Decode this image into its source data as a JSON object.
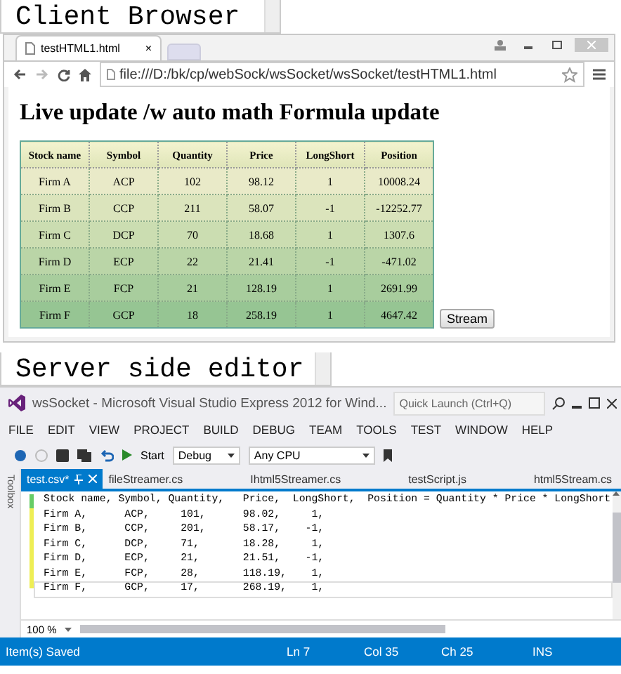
{
  "client_label": "Client Browser",
  "browser": {
    "tab": {
      "title": "testHTML1.html",
      "close": "×"
    },
    "url": "file:///D:/bk/cp/webSock/wsSocket/wsSocket/testHTML1.html",
    "heading": "Live update /w auto math Formula update",
    "table": {
      "columns": [
        "Stock name",
        "Symbol",
        "Quantity",
        "Price",
        "LongShort",
        "Position"
      ],
      "rows": [
        [
          "Firm A",
          "ACP",
          "102",
          "98.12",
          "1",
          "10008.24"
        ],
        [
          "Firm B",
          "CCP",
          "211",
          "58.07",
          "-1",
          "-12252.77"
        ],
        [
          "Firm C",
          "DCP",
          "70",
          "18.68",
          "1",
          "1307.6"
        ],
        [
          "Firm D",
          "ECP",
          "22",
          "21.41",
          "-1",
          "-471.02"
        ],
        [
          "Firm E",
          "FCP",
          "21",
          "128.19",
          "1",
          "2691.99"
        ],
        [
          "Firm F",
          "GCP",
          "18",
          "258.19",
          "1",
          "4647.42"
        ]
      ]
    },
    "button": "Stream"
  },
  "server_label": "Server side editor",
  "ide": {
    "title": "wsSocket - Microsoft Visual Studio Express 2012 for Wind...",
    "quick_launch": {
      "placeholder": "Quick Launch (Ctrl+Q)"
    },
    "menu": [
      "FILE",
      "EDIT",
      "VIEW",
      "PROJECT",
      "BUILD",
      "DEBUG",
      "TEAM",
      "TOOLS",
      "TEST",
      "WINDOW",
      "HELP"
    ],
    "toolbar": {
      "start": "Start",
      "config": "Debug",
      "platform": "Any CPU"
    },
    "toolbox": "Toolbox",
    "tabs": [
      {
        "label": "test.csv*",
        "selected": true
      },
      {
        "label": "fileStreamer.cs",
        "selected": false
      },
      {
        "label": "Ihtml5Streamer.cs",
        "selected": false
      },
      {
        "label": "testScript.js",
        "selected": false
      },
      {
        "label": "html5Stream.cs",
        "selected": false
      }
    ],
    "lines": [
      {
        "text": "Stock name, Symbol, Quantity,   Price,  LongShort,  Position = Quantity * Price * LongShort",
        "current": false
      },
      {
        "text": "Firm A,      ACP,     101,      98.02,     1,",
        "current": false
      },
      {
        "text": "Firm B,      CCP,     201,      58.17,    -1,",
        "current": false
      },
      {
        "text": "Firm C,      DCP,     71,       18.28,     1,",
        "current": false
      },
      {
        "text": "Firm D,      ECP,     21,       21.51,    -1,",
        "current": false
      },
      {
        "text": "Firm E,      FCP,     28,       118.19,    1,",
        "current": false
      },
      {
        "text": "Firm F,      GCP,     17,       268.19,    1,",
        "current": true
      }
    ],
    "zoom": "100 %",
    "status": [
      "Item(s) Saved",
      "Ln 7",
      "Col 35",
      "Ch 25",
      "INS"
    ]
  }
}
